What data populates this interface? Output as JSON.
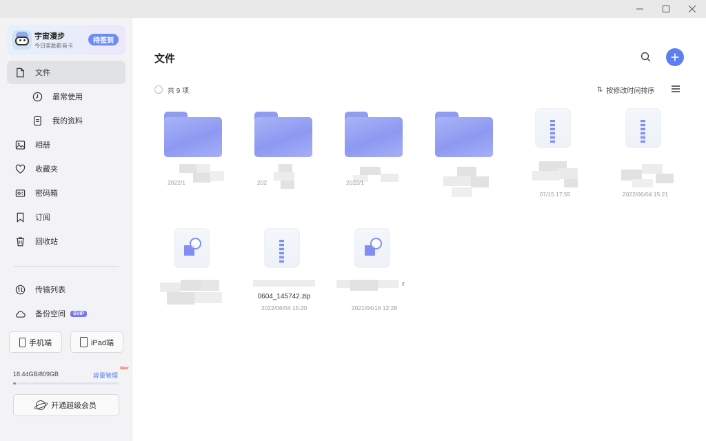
{
  "window": {
    "min": "—",
    "max": "☐",
    "close": "✕"
  },
  "user": {
    "name": "宇宙漫步",
    "subtitle": "今日奖励影音卡",
    "checkin_label": "待签到"
  },
  "sidebar": {
    "items": [
      {
        "label": "文件",
        "icon": "file-icon"
      },
      {
        "label": "最常使用",
        "icon": "clock-icon"
      },
      {
        "label": "我的资料",
        "icon": "document-icon"
      },
      {
        "label": "相册",
        "icon": "photo-icon"
      },
      {
        "label": "收藏夹",
        "icon": "heart-icon"
      },
      {
        "label": "密码箱",
        "icon": "safe-icon"
      },
      {
        "label": "订阅",
        "icon": "bookmark-icon"
      },
      {
        "label": "回收站",
        "icon": "trash-icon"
      }
    ],
    "tools": [
      {
        "label": "传输列表",
        "icon": "transfer-icon"
      },
      {
        "label": "备份空间",
        "icon": "cloud-icon",
        "badge": "SVIP"
      }
    ],
    "devices": {
      "phone": "手机端",
      "ipad": "iPad端"
    },
    "storage": {
      "text": "18.44GB/809GB",
      "manage": "容量管理",
      "new_tag": "New",
      "used_fraction": 0.023
    },
    "vip_label": "开通超级会员"
  },
  "main": {
    "title": "文件",
    "count": "共 9 项",
    "sort_label": "按修改时间排序",
    "files": [
      {
        "type": "folder",
        "name": "",
        "date": "2022/1"
      },
      {
        "type": "folder",
        "name": "",
        "date": "202"
      },
      {
        "type": "folder",
        "name": "",
        "date": "2022/1"
      },
      {
        "type": "folder",
        "name": "",
        "date": ""
      },
      {
        "type": "zip",
        "name": "",
        "date": "07/15 17:55"
      },
      {
        "type": "zip",
        "name": "",
        "date": "2022/06/04 15:21"
      },
      {
        "type": "file",
        "name": "",
        "date": ""
      },
      {
        "type": "zip",
        "name": "0604_145742.zip",
        "date": "2022/06/04 15:20"
      },
      {
        "type": "file",
        "name": "r",
        "date": "2021/04/16 12:28"
      }
    ]
  }
}
